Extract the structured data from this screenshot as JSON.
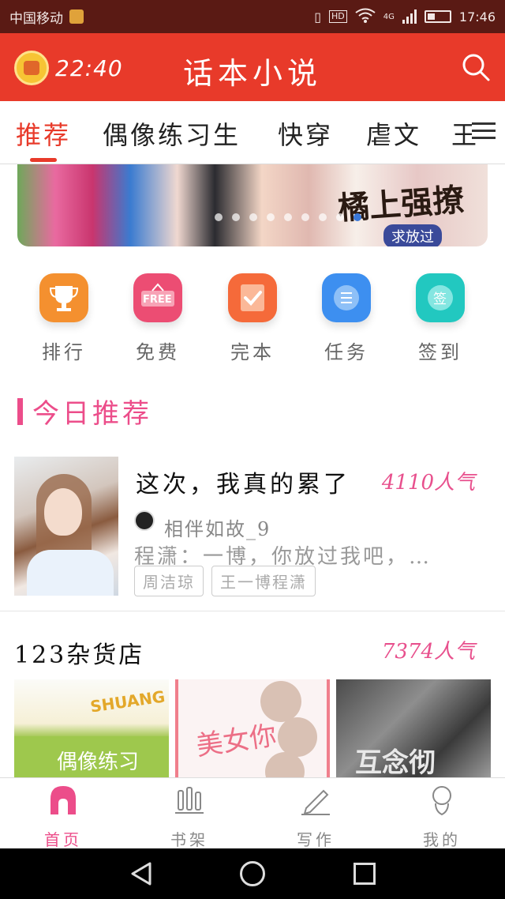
{
  "status_bar": {
    "carrier": "中国移动",
    "network_badge": "HD",
    "network_type": "4G",
    "time": "17:46"
  },
  "app_bar": {
    "timer": "22:40",
    "title": "话本小说"
  },
  "tabs": [
    {
      "label": "推荐",
      "active": true
    },
    {
      "label": "偶像练习生",
      "active": false
    },
    {
      "label": "快穿",
      "active": false
    },
    {
      "label": "虐文",
      "active": false
    },
    {
      "label": "王",
      "active": false
    }
  ],
  "banner": {
    "text": "橘上强撩",
    "tag": "求放过"
  },
  "quick_actions": [
    {
      "label": "排行",
      "icon": "trophy-icon",
      "color": "#f4902f"
    },
    {
      "label": "免费",
      "icon": "free-sign-icon",
      "color": "#ec4d73",
      "badge": "FREE"
    },
    {
      "label": "完本",
      "icon": "checkmark-icon",
      "color": "#f56a3a"
    },
    {
      "label": "任务",
      "icon": "list-icon",
      "color": "#3d8ff0"
    },
    {
      "label": "签到",
      "icon": "sign-in-icon",
      "color": "#22c8c0",
      "badge": "签"
    }
  ],
  "today_section": {
    "title": "今日推荐"
  },
  "featured_book": {
    "title": "这次，我真的累了",
    "popularity": "4110人气",
    "author": "相伴如故_9",
    "description": "程潇：一博，你放过我吧，…",
    "tags": [
      "周洁琼",
      "王一博程潇"
    ]
  },
  "shop_section": {
    "title": "123杂货店",
    "popularity": "7374人气",
    "covers": [
      {
        "text": "偶像练习",
        "word": "SHUANG"
      },
      {
        "text": "美女你"
      },
      {
        "text": "互念彻"
      }
    ]
  },
  "bottom_nav": [
    {
      "label": "首页",
      "icon": "home-icon",
      "active": true
    },
    {
      "label": "书架",
      "icon": "bookshelf-icon",
      "active": false
    },
    {
      "label": "写作",
      "icon": "pen-icon",
      "active": false
    },
    {
      "label": "我的",
      "icon": "profile-icon",
      "active": false
    }
  ],
  "colors": {
    "brand_red": "#e83a2a",
    "accent_pink": "#ec4d8a",
    "status_bar": "#5a1a14"
  }
}
